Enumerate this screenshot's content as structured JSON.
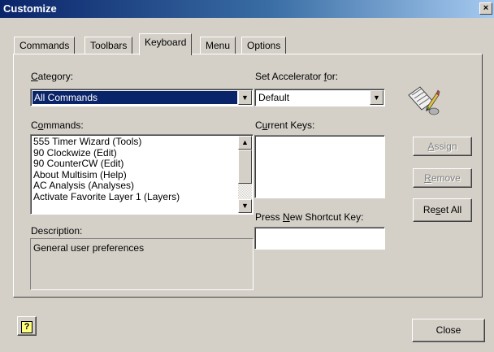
{
  "window": {
    "title": "Customize",
    "close_glyph": "×"
  },
  "tabs": [
    {
      "label": "Commands"
    },
    {
      "label": "Toolbars"
    },
    {
      "label": "Keyboard"
    },
    {
      "label": "Menu"
    },
    {
      "label": "Options"
    }
  ],
  "active_tab": "Keyboard",
  "category": {
    "label_access": "C",
    "label_rest": "ategory:",
    "value": "All Commands"
  },
  "commands": {
    "label_pre": "C",
    "label_access": "o",
    "label_rest": "mmands:",
    "items": [
      "555 Timer Wizard (Tools)",
      "90 Clockwize (Edit)",
      "90 CounterCW (Edit)",
      "About Multisim (Help)",
      "AC Analysis (Analyses)",
      "Activate Favorite Layer 1 (Layers)"
    ]
  },
  "description": {
    "label": "Description:",
    "text": "General user preferences"
  },
  "accelerator": {
    "label_pre": "Set Accelerator ",
    "label_access": "f",
    "label_rest": "or:",
    "value": "Default"
  },
  "current_keys": {
    "label_pre": "C",
    "label_access": "u",
    "label_rest": "rrent Keys:"
  },
  "shortcut": {
    "label_pre": "Press ",
    "label_access": "N",
    "label_rest": "ew Shortcut Key:",
    "value": ""
  },
  "buttons": {
    "assign": {
      "access": "A",
      "rest": "ssign",
      "enabled": false
    },
    "remove": {
      "access": "R",
      "rest": "emove",
      "enabled": false
    },
    "reset_all": {
      "pre": "Re",
      "access": "s",
      "rest": "et All",
      "enabled": true
    },
    "close": "Close",
    "help_glyph": "?"
  },
  "icons": {
    "keyboard": "keyboard-pencil-icon",
    "help": "help-icon",
    "dropdown": "chevron-down-icon",
    "scroll_up": "scroll-up-icon",
    "scroll_down": "scroll-down-icon"
  },
  "colors": {
    "title_start": "#0a246a",
    "title_end": "#a6caf0",
    "selection": "#0a246a",
    "face": "#d4d0c8"
  }
}
